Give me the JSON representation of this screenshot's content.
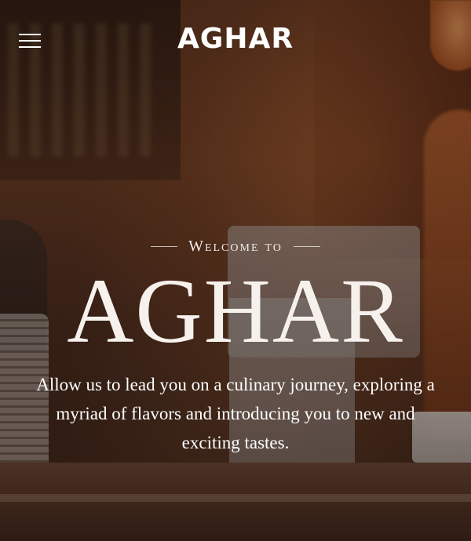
{
  "header": {
    "logo_text": "AGHAR",
    "menu_icon": "hamburger-menu-icon"
  },
  "hero": {
    "welcome": "Welcome to",
    "title": "AGHAR",
    "tagline": "Allow us to lead you on a culinary journey, exploring a myriad of flavors and introducing you to new and exciting tastes."
  },
  "colors": {
    "text": "#ffffff",
    "overlay": "#140a06",
    "warm_accent": "#c56a35"
  }
}
